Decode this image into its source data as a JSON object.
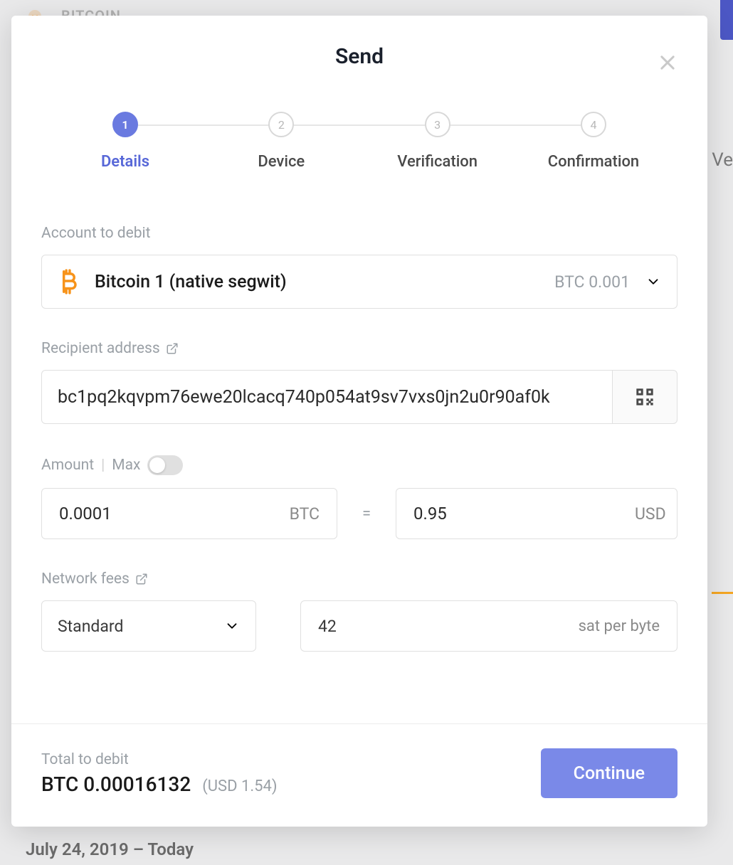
{
  "background": {
    "currency_label": "BITCOIN",
    "date_line": "July 24, 2019 – Today",
    "right_char": "Ve"
  },
  "modal": {
    "title": "Send",
    "steps": [
      {
        "num": "1",
        "label": "Details"
      },
      {
        "num": "2",
        "label": "Device"
      },
      {
        "num": "3",
        "label": "Verification"
      },
      {
        "num": "4",
        "label": "Confirmation"
      }
    ],
    "labels": {
      "account": "Account to debit",
      "recipient": "Recipient address",
      "amount": "Amount",
      "max": "Max",
      "fees": "Network fees",
      "total": "Total to debit"
    },
    "account": {
      "name": "Bitcoin 1 (native segwit)",
      "balance": "BTC 0.001"
    },
    "recipient": {
      "value": "bc1pq2kqvpm76ewe20lcacq740p054at9sv7vxs0jn2u0r90af0k"
    },
    "amount": {
      "crypto_value": "0.0001",
      "crypto_unit": "BTC",
      "equals": "=",
      "fiat_value": "0.95",
      "fiat_unit": "USD"
    },
    "fees": {
      "tier": "Standard",
      "rate_value": "42",
      "rate_unit": "sat per byte"
    },
    "total": {
      "crypto": "BTC 0.00016132",
      "fiat": "(USD 1.54)"
    },
    "continue_label": "Continue"
  }
}
